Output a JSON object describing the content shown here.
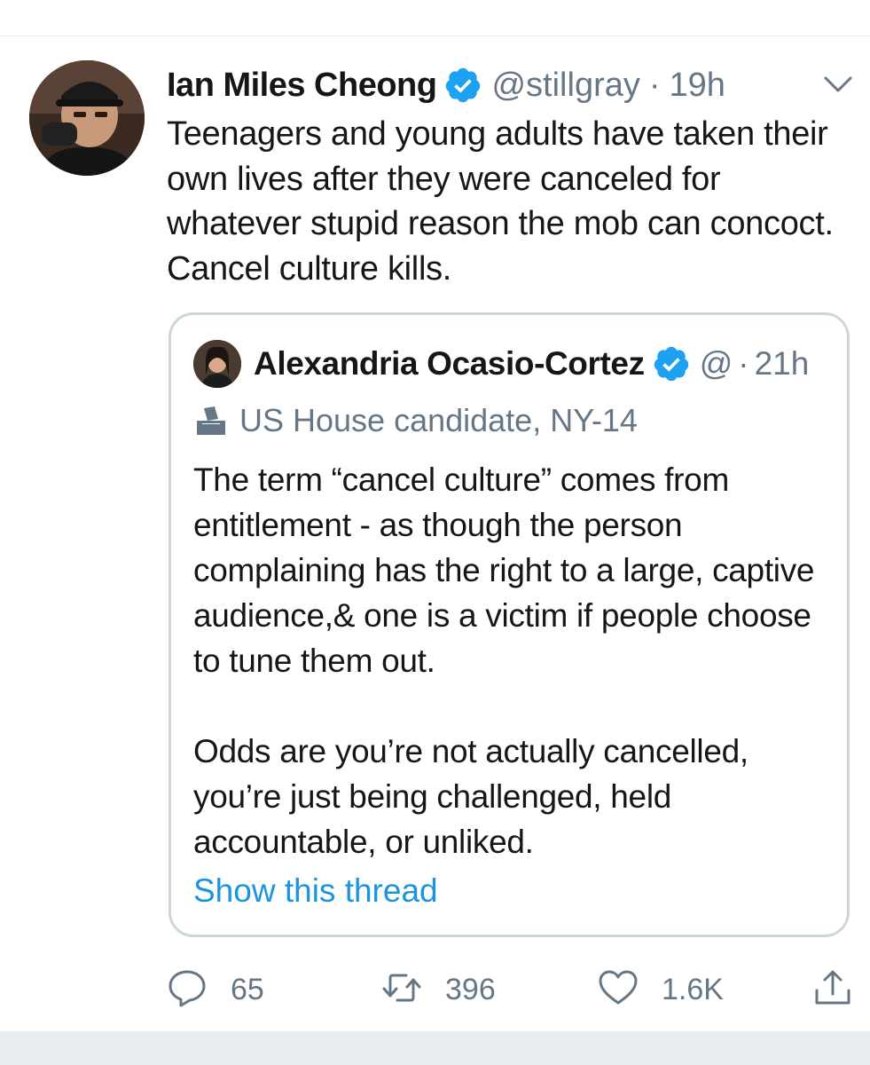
{
  "tweet": {
    "author_name": "Ian Miles Cheong",
    "handle": "@stillgray",
    "separator": "·",
    "time": "19h",
    "text": "Teenagers and young adults have taken their own lives after they were canceled for whatever stupid reason the mob can concoct. Cancel culture kills.",
    "icons": {
      "avatar": "avatar-photo",
      "verified": "verified-badge-icon",
      "menu": "chevron-down-icon"
    }
  },
  "quote": {
    "author_name": "Alexandria Ocasio-Cortez",
    "handle_fragment": "@",
    "separator": "·",
    "time": "21h",
    "bio_label": "US House candidate, NY-14",
    "paragraph1": "The term “cancel culture” comes from entitlement - as though the person complaining has the right to a large, captive audience,& one is a victim if people choose to tune them out.",
    "paragraph2": "Odds are you’re not actually cancelled, you’re just being challenged, held accountable, or unliked.",
    "show_thread": "Show this thread",
    "icons": {
      "verified": "verified-badge-icon",
      "label": "ballot-box-icon"
    }
  },
  "actions": {
    "replies": "65",
    "retweets": "396",
    "likes": "1.6K",
    "icons": [
      "reply-icon",
      "retweet-icon",
      "like-icon",
      "share-icon"
    ]
  },
  "colors": {
    "text": "#14171a",
    "secondary": "#657786",
    "link": "#1b95e0",
    "verified": "#1da1f2",
    "border": "#ccd6dd",
    "divider": "#e6ecf0"
  }
}
